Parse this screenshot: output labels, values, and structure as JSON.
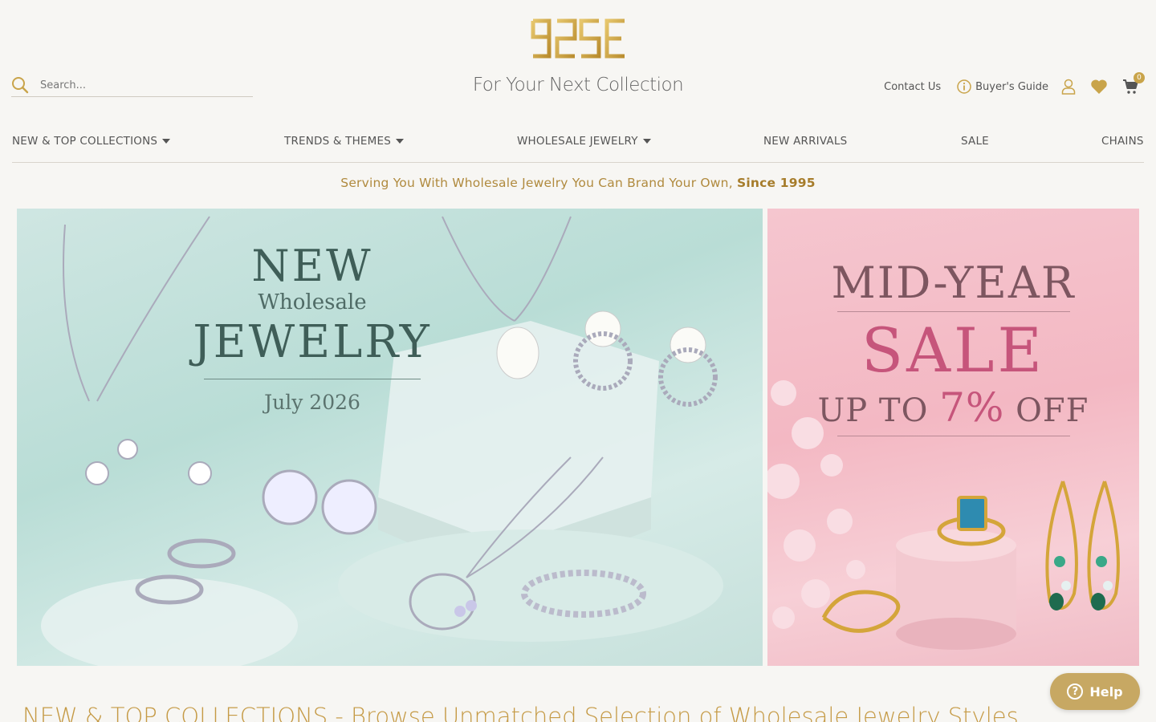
{
  "header": {
    "logo_text": "925E",
    "tagline": "For Your Next Collection",
    "search_placeholder": "Search...",
    "contact_label": "Contact Us",
    "buyers_guide_label": "Buyer's Guide",
    "cart_count": "0"
  },
  "nav": {
    "items": [
      {
        "label": "NEW & TOP COLLECTIONS"
      },
      {
        "label": "TRENDS & THEMES"
      },
      {
        "label": "WHOLESALE JEWELRY"
      },
      {
        "label": "NEW ARRIVALS"
      },
      {
        "label": "SALE"
      },
      {
        "label": "CHAINS"
      }
    ]
  },
  "promo": {
    "text": "Serving You With Wholesale Jewelry You Can Brand Your Own, ",
    "emphasis": "Since 1995"
  },
  "banner_left": {
    "line1": "NEW",
    "line2": "Wholesale",
    "line3": "JEWELRY",
    "date": "July 2026"
  },
  "banner_right": {
    "line1": "MID-YEAR",
    "line2": "SALE",
    "line3_prefix": "UP TO ",
    "line3_value": "7%",
    "line3_suffix": " OFF"
  },
  "section": {
    "heading": "NEW & TOP COLLECTIONS - Browse Unmatched Selection of Wholesale Jewelry Styles"
  },
  "help": {
    "label": "Help"
  },
  "colors": {
    "gold": "#c9a44a",
    "background": "#f7f6f3"
  }
}
